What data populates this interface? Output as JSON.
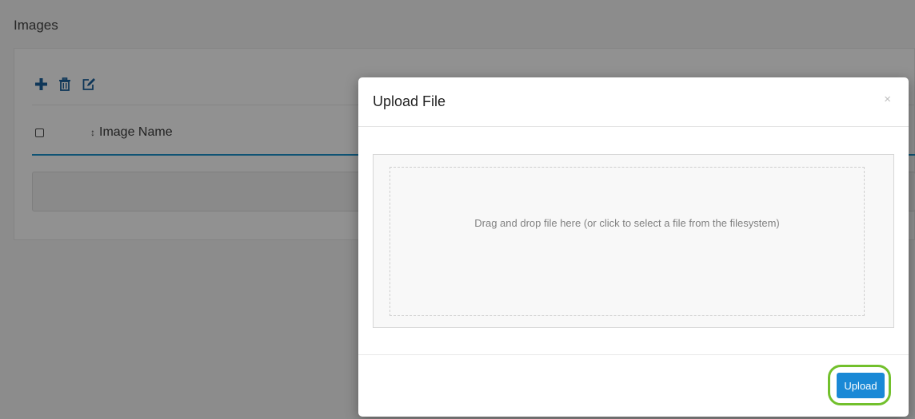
{
  "page": {
    "title": "Images"
  },
  "toolbar": {
    "add_icon": "plus-icon",
    "delete_icon": "trash-icon",
    "edit_icon": "edit-icon"
  },
  "table": {
    "columns": [
      {
        "label": "Image Name",
        "sortable": true
      }
    ]
  },
  "modal": {
    "title": "Upload File",
    "close_label": "×",
    "dropzone_text": "Drag and drop file here (or click to select a file from the filesystem)",
    "upload_label": "Upload"
  },
  "colors": {
    "accent": "#1a89d6",
    "table_header_border": "#1b8fc9",
    "highlight": "#72c02c"
  }
}
